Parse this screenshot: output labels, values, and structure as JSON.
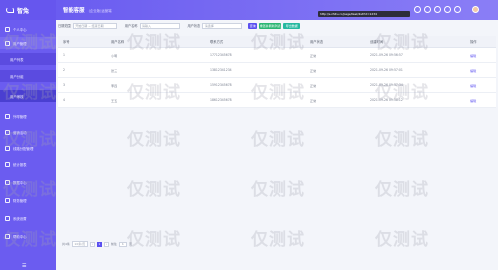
{
  "app": {
    "name": "智兔",
    "title": "智能客服",
    "subtitle": "(企业版)运营端"
  },
  "url_tip": "http://s.zhitu.cc/page/task/list?id=1234",
  "sidebar": {
    "items": [
      {
        "label": "个人中心"
      },
      {
        "label": "用户管理"
      },
      {
        "label": "用户列表"
      },
      {
        "label": "用户分组"
      },
      {
        "label": "用户审核"
      },
      {
        "label": "外呼管理"
      },
      {
        "label": "营销活动"
      },
      {
        "label": "线路分配管理"
      },
      {
        "label": "统计报表"
      },
      {
        "label": "数据中心"
      },
      {
        "label": "财务管理"
      },
      {
        "label": "系统设置"
      },
      {
        "label": "帮助中心"
      }
    ],
    "collapse_glyph": "☰"
  },
  "filters": {
    "date_label": "日期范围",
    "date_placeholder": "开始日期 ~ 结束日期",
    "name_label": "用户名称",
    "name_placeholder": "请输入",
    "status_label": "用户状态",
    "status_placeholder": "请选择",
    "search": "查询",
    "reset": "重置并刷新列表",
    "export": "导出数据"
  },
  "table": {
    "columns": [
      "序号",
      "用户名称",
      "联系方式",
      "用户状态",
      "创建时间",
      "操作"
    ],
    "rows": [
      [
        "1",
        "小明",
        "17712345678",
        "正常",
        "2021-09-26 09:56:57",
        "编辑"
      ],
      [
        "2",
        "张三",
        "13812341234",
        "正常",
        "2021-09-26 09:57:01",
        "编辑"
      ],
      [
        "3",
        "李四",
        "15912345678",
        "正常",
        "2021-09-26 09:57:34",
        "编辑"
      ],
      [
        "4",
        "王五",
        "18612345678",
        "正常",
        "2021-09-26 09:58:12",
        "编辑"
      ]
    ]
  },
  "pager": {
    "total": "共4条",
    "size": "10条/页",
    "prev": "‹",
    "current": "1",
    "next": "›",
    "goto": "前往",
    "page_box": "1",
    "page_unit": "页"
  },
  "watermark": "仅测试"
}
